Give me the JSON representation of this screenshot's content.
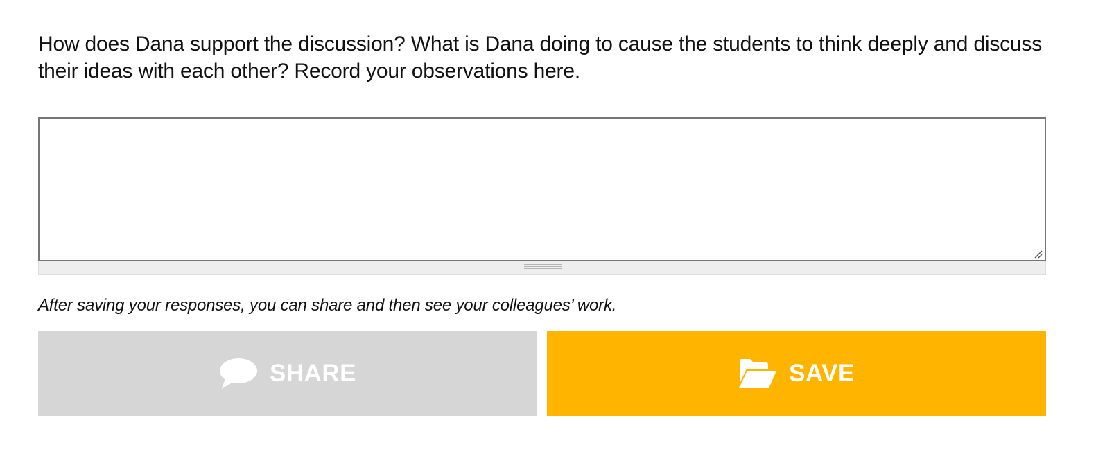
{
  "question": {
    "text": "How does Dana support the discussion? What is Dana doing to cause the students to think deeply and discuss their ideas with each other? Record your observations here."
  },
  "response": {
    "value": "",
    "placeholder": ""
  },
  "note": {
    "text": "After saving your responses, you can share and then see your colleagues’ work."
  },
  "buttons": {
    "share": {
      "label": "SHARE",
      "icon": "speech-bubble-icon",
      "background": "#d6d6d6",
      "state": "disabled"
    },
    "save": {
      "label": "SAVE",
      "icon": "open-folder-icon",
      "background": "#ffb400"
    }
  }
}
